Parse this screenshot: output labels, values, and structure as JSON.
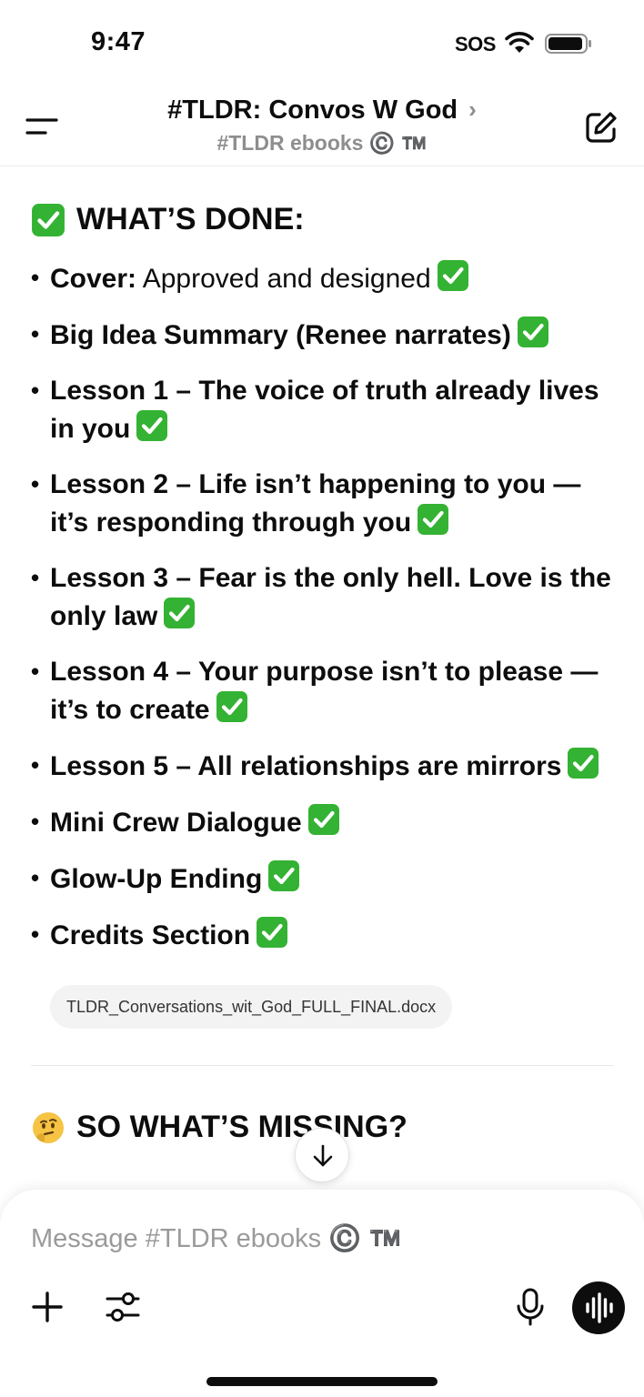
{
  "status_bar": {
    "time": "9:47",
    "sos": "SOS"
  },
  "nav": {
    "title": "#TLDR: Convos W God",
    "chevron": "›",
    "subtitle": "#TLDR ebooks ©️ ™️"
  },
  "content": {
    "done_heading": "WHAT’S DONE:",
    "done_items": [
      {
        "bold": "Cover:",
        "normal": " Approved and designed"
      },
      {
        "bold": "Big Idea Summary (Renee narrates)",
        "normal": ""
      },
      {
        "bold": "Lesson 1 – The voice of truth already lives in you",
        "normal": ""
      },
      {
        "bold": "Lesson 2 – Life isn’t happening to you — it’s responding through you",
        "normal": ""
      },
      {
        "bold": "Lesson 3 – Fear is the only hell. Love is the only law",
        "normal": ""
      },
      {
        "bold": "Lesson 4 – Your purpose isn’t to please — it’s to create",
        "normal": ""
      },
      {
        "bold": "Lesson 5 – All relationships are mirrors",
        "normal": ""
      },
      {
        "bold": "Mini Crew Dialogue",
        "normal": ""
      },
      {
        "bold": "Glow-Up Ending",
        "normal": ""
      },
      {
        "bold": "Credits Section",
        "normal": ""
      }
    ],
    "file_name": "TLDR_Conversations_wit_God_FULL_FINAL.docx",
    "missing_heading": "SO WHAT’S MISSING?"
  },
  "composer": {
    "placeholder": "Message #TLDR ebooks ©️ ™️"
  },
  "icons": {
    "check": "white-check-mark-icon",
    "thinking": "thinking-face-icon"
  },
  "colors": {
    "check_green": "#34b233",
    "text": "#0d0d0d",
    "muted": "#8e8e8e"
  }
}
